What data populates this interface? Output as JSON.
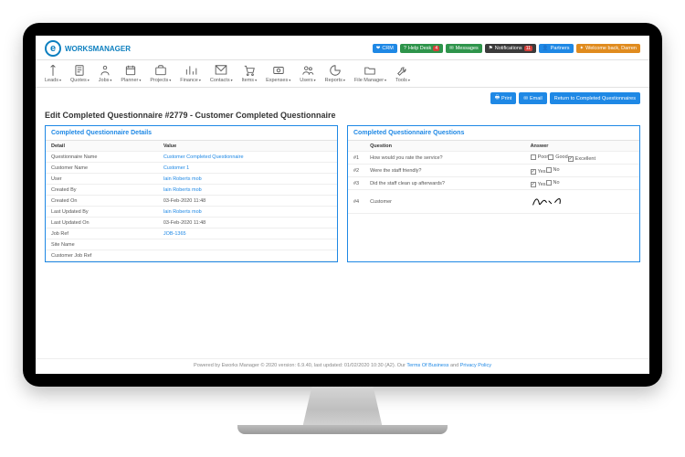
{
  "brand": {
    "name": "WORKSMANAGER",
    "letter": "e"
  },
  "header_badges": {
    "crm": "CRM",
    "help": "Help Desk",
    "help_count": "4",
    "messages": "Messages",
    "notifications": "Notifications",
    "notif_count": "11",
    "partners": "Partners",
    "welcome": "Welcome back, Darren"
  },
  "toolbar": {
    "leads": "Leads",
    "quotes": "Quotes",
    "jobs": "Jobs",
    "planner": "Planner",
    "projects": "Projects",
    "finance": "Finance",
    "contacts": "Contacts",
    "items": "Items",
    "expenses": "Expenses",
    "users": "Users",
    "reports": "Reports",
    "file_manager": "File Manager",
    "tools": "Tools"
  },
  "actions": {
    "print": "Print",
    "email": "Email",
    "return": "Return to Completed Questionnaires"
  },
  "page_title": "Edit Completed Questionnaire #2779 - Customer Completed Questionnaire",
  "details": {
    "heading": "Completed Questionnaire Details",
    "cols": {
      "detail": "Detail",
      "value": "Value"
    },
    "rows": [
      {
        "label": "Questionnaire Name",
        "value": "Customer Completed Questionnaire",
        "link": true
      },
      {
        "label": "Customer Name",
        "value": "Customer 1",
        "link": true
      },
      {
        "label": "User",
        "value": "Iain Roberts mob",
        "link": true
      },
      {
        "label": "Created By",
        "value": "Iain Roberts mob",
        "link": true
      },
      {
        "label": "Created On",
        "value": "03-Feb-2020 11:48"
      },
      {
        "label": "Last Updated By",
        "value": "Iain Roberts mob",
        "link": true
      },
      {
        "label": "Last Updated On",
        "value": "03-Feb-2020 11:48"
      },
      {
        "label": "Job Ref",
        "value": "JOB-1365",
        "link": true
      },
      {
        "label": "Site Name",
        "value": ""
      },
      {
        "label": "Customer Job Ref",
        "value": ""
      }
    ]
  },
  "questions": {
    "heading": "Completed Questionnaire Questions",
    "cols": {
      "num": "",
      "q": "Question",
      "a": "Answer"
    },
    "items": [
      {
        "num": "#1",
        "q": "How would you rate the service?",
        "opts": [
          {
            "label": "Poor",
            "checked": false
          },
          {
            "label": "Good",
            "checked": false
          },
          {
            "label": "Excellent",
            "checked": true
          }
        ]
      },
      {
        "num": "#2",
        "q": "Were the staff friendly?",
        "opts": [
          {
            "label": "Yes",
            "checked": true
          },
          {
            "label": "No",
            "checked": false
          }
        ]
      },
      {
        "num": "#3",
        "q": "Did the staff clean up afterwards?",
        "opts": [
          {
            "label": "Yes",
            "checked": true
          },
          {
            "label": "No",
            "checked": false
          }
        ]
      },
      {
        "num": "#4",
        "q": "Customer",
        "signature": true
      }
    ]
  },
  "footer": {
    "prefix": "Powered by Eworks Manager © 2020 version: 6.9.40, last updated: 01/02/2020 10:30 (A2). Our ",
    "tob": "Terms Of Business",
    "and": " and ",
    "pp": "Privacy Policy"
  }
}
